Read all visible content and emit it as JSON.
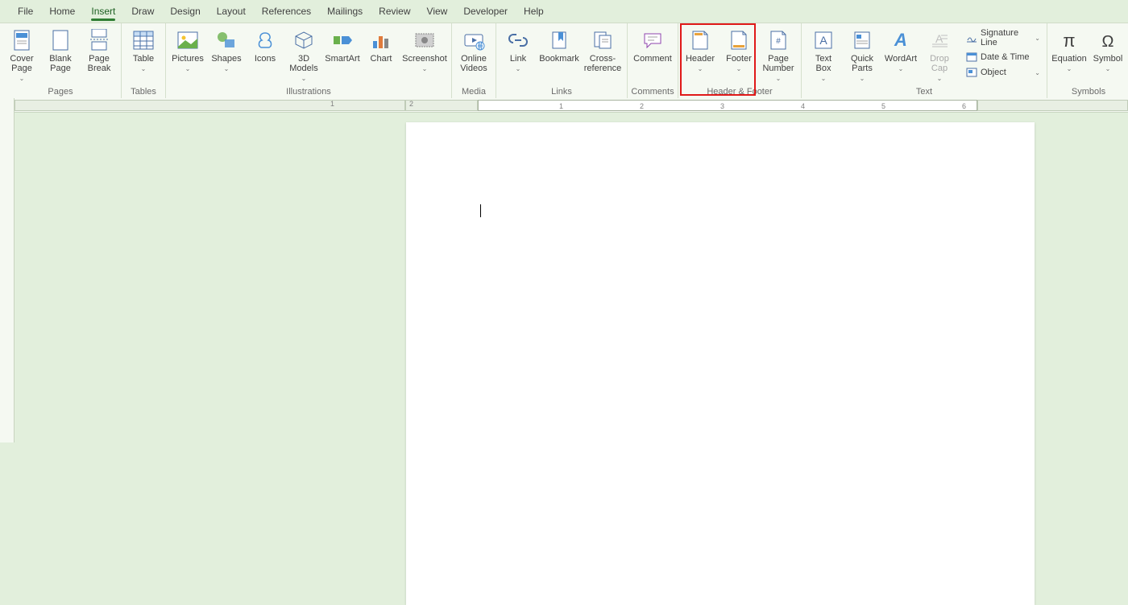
{
  "menu": [
    "File",
    "Home",
    "Insert",
    "Draw",
    "Design",
    "Layout",
    "References",
    "Mailings",
    "Review",
    "View",
    "Developer",
    "Help"
  ],
  "active_menu_index": 2,
  "groups": {
    "pages": {
      "label": "Pages",
      "items": [
        {
          "name": "cover-page",
          "label": "Cover\nPage",
          "has_arrow": true
        },
        {
          "name": "blank-page",
          "label": "Blank\nPage",
          "has_arrow": false
        },
        {
          "name": "page-break",
          "label": "Page\nBreak",
          "has_arrow": false
        }
      ]
    },
    "tables": {
      "label": "Tables",
      "items": [
        {
          "name": "table",
          "label": "Table",
          "has_arrow": true
        }
      ]
    },
    "illustrations": {
      "label": "Illustrations",
      "items": [
        {
          "name": "pictures",
          "label": "Pictures",
          "has_arrow": true
        },
        {
          "name": "shapes",
          "label": "Shapes",
          "has_arrow": true
        },
        {
          "name": "icons",
          "label": "Icons",
          "has_arrow": false
        },
        {
          "name": "3d-models",
          "label": "3D\nModels",
          "has_arrow": true
        },
        {
          "name": "smartart",
          "label": "SmartArt",
          "has_arrow": false
        },
        {
          "name": "chart",
          "label": "Chart",
          "has_arrow": false
        },
        {
          "name": "screenshot",
          "label": "Screenshot",
          "has_arrow": true
        }
      ]
    },
    "media": {
      "label": "Media",
      "items": [
        {
          "name": "online-videos",
          "label": "Online\nVideos",
          "has_arrow": false
        }
      ]
    },
    "links": {
      "label": "Links",
      "items": [
        {
          "name": "link",
          "label": "Link",
          "has_arrow": true
        },
        {
          "name": "bookmark",
          "label": "Bookmark",
          "has_arrow": false
        },
        {
          "name": "cross-reference",
          "label": "Cross-\nreference",
          "has_arrow": false
        }
      ]
    },
    "comments": {
      "label": "Comments",
      "items": [
        {
          "name": "comment",
          "label": "Comment",
          "has_arrow": false
        }
      ]
    },
    "header_footer": {
      "label": "Header & Footer",
      "items": [
        {
          "name": "header",
          "label": "Header",
          "has_arrow": true,
          "highlighted": true
        },
        {
          "name": "footer",
          "label": "Footer",
          "has_arrow": true,
          "highlighted": true
        },
        {
          "name": "page-number",
          "label": "Page\nNumber",
          "has_arrow": true
        }
      ]
    },
    "text": {
      "label": "Text",
      "big_items": [
        {
          "name": "text-box",
          "label": "Text\nBox",
          "has_arrow": true
        },
        {
          "name": "quick-parts",
          "label": "Quick\nParts",
          "has_arrow": true
        },
        {
          "name": "wordart",
          "label": "WordArt",
          "has_arrow": true
        },
        {
          "name": "drop-cap",
          "label": "Drop\nCap",
          "has_arrow": true,
          "disabled": true
        }
      ],
      "mini_items": [
        {
          "name": "signature-line",
          "label": "Signature Line",
          "has_arrow": true
        },
        {
          "name": "date-time",
          "label": "Date & Time",
          "has_arrow": false
        },
        {
          "name": "object",
          "label": "Object",
          "has_arrow": true
        }
      ]
    },
    "symbols": {
      "label": "Symbols",
      "items": [
        {
          "name": "equation",
          "label": "Equation",
          "has_arrow": true
        },
        {
          "name": "symbol",
          "label": "Symbol",
          "has_arrow": true
        }
      ]
    }
  },
  "ruler_ticks": [
    "1",
    "2",
    "1",
    "2",
    "3",
    "4",
    "5",
    "6"
  ],
  "highlight_box": {
    "group": "header_footer",
    "start": 0,
    "end": 1
  }
}
